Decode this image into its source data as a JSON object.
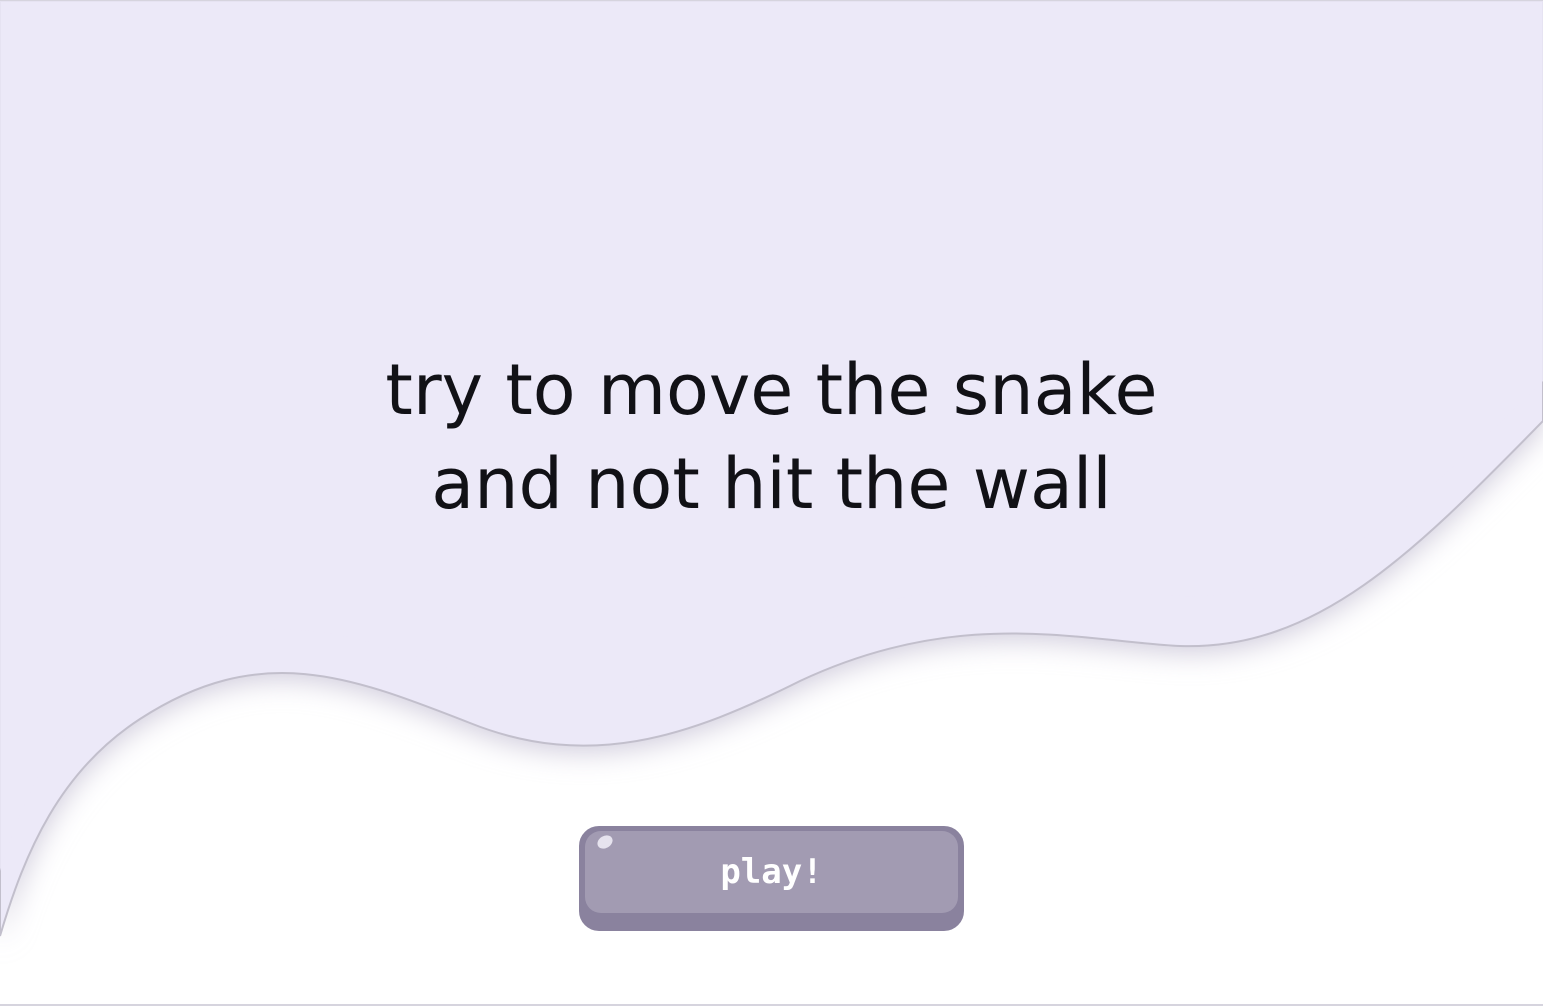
{
  "screen": {
    "instructions": {
      "line1": "try to move the snake",
      "line2": "and not hit the wall"
    },
    "play_button": {
      "label": "play!"
    }
  },
  "colors": {
    "background": "#ffffff",
    "blob_fill": "#ece9f8",
    "blob_shadow": "#c6c2d3",
    "text": "#111116",
    "button_face": "#a29bb2",
    "button_base": "#8a829e",
    "button_label": "#ffffff"
  }
}
